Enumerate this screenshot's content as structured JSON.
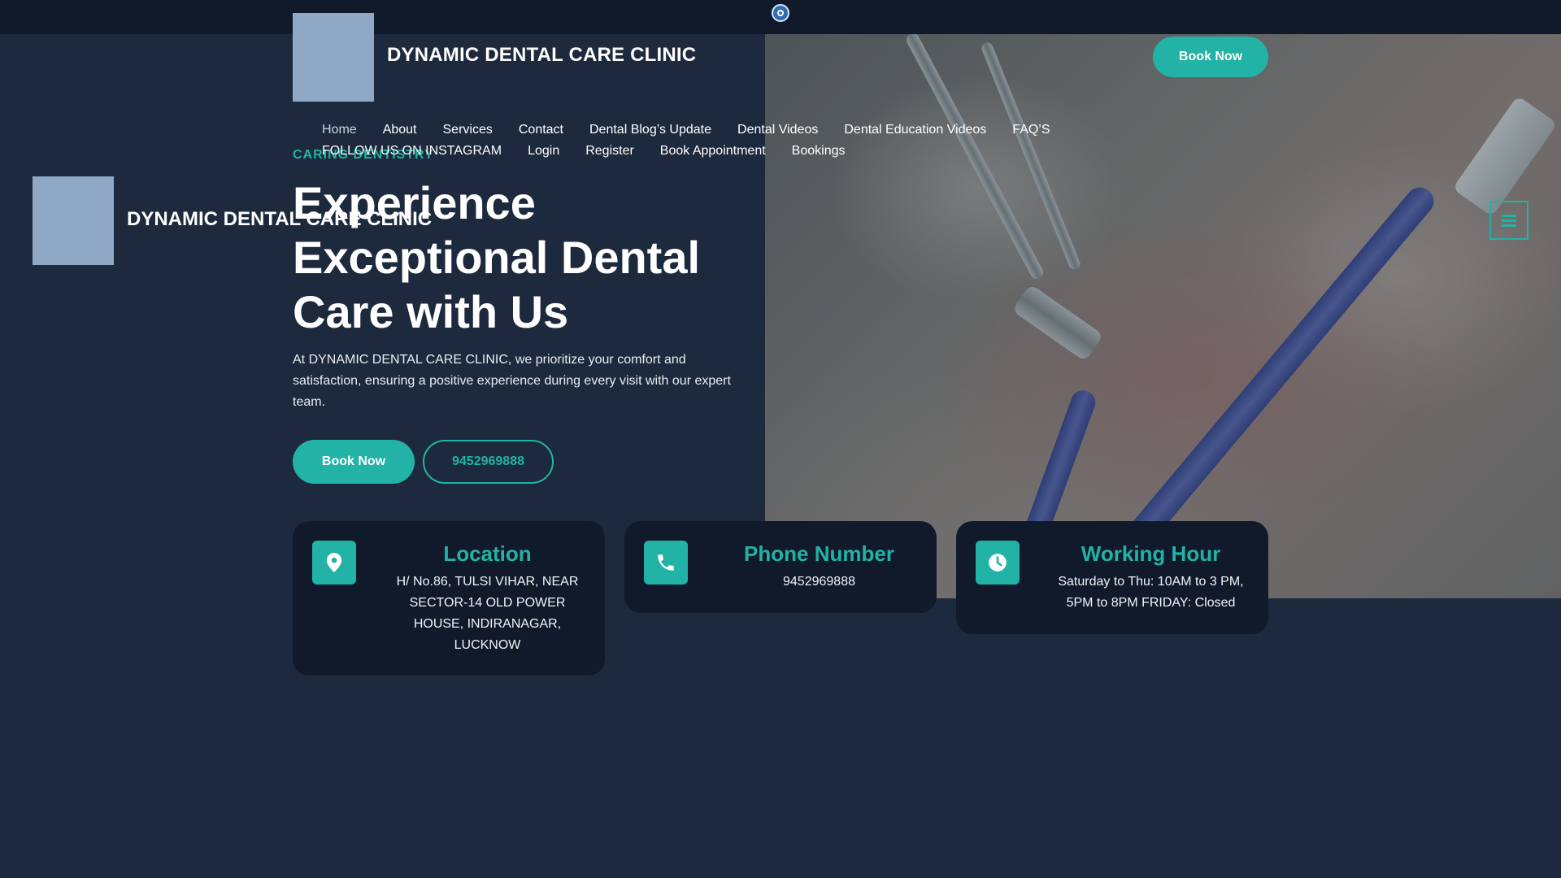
{
  "header": {
    "title": "DYNAMIC DENTAL CARE CLINIC",
    "book_label": "Book Now"
  },
  "nav": {
    "row1": [
      "Home",
      "About",
      "Services",
      "Contact",
      "Dental Blog’s Update",
      "Dental Videos",
      "Dental Education Videos",
      "FAQ’S"
    ],
    "row2": [
      "FOLLOW US ON INSTAGRAM",
      "Login",
      "Register",
      "Book Appointment",
      "Bookings"
    ]
  },
  "side": {
    "title": "DYNAMIC DENTAL CARE CLINIC"
  },
  "hero": {
    "eyebrow": "CARING DENTISTRY",
    "heading": "Experience Exceptional Dental Care with Us",
    "text": "At DYNAMIC DENTAL CARE CLINIC, we prioritize your comfort and satisfaction, ensuring a positive experience during every visit with our expert team.",
    "primary_button": "Book Now",
    "phone_button": "9452969888"
  },
  "cards": {
    "location": {
      "title": "Location",
      "text": "H/ No.86, TULSI VIHAR, NEAR SECTOR-14 OLD POWER HOUSE, INDIRANAGAR, LUCKNOW",
      "icon": "map-pin-icon"
    },
    "phone": {
      "title": "Phone Number",
      "text": "9452969888",
      "icon": "phone-icon"
    },
    "hours": {
      "title": "Working Hour",
      "text": "Saturday to Thu: 10AM to 3 PM, 5PM to 8PM FRIDAY: Closed",
      "icon": "clock-icon"
    }
  },
  "colors": {
    "accent": "#22b3a6",
    "background": "#1d2a3d",
    "card": "#111a2b",
    "logo_placeholder": "#8ea8c6"
  }
}
